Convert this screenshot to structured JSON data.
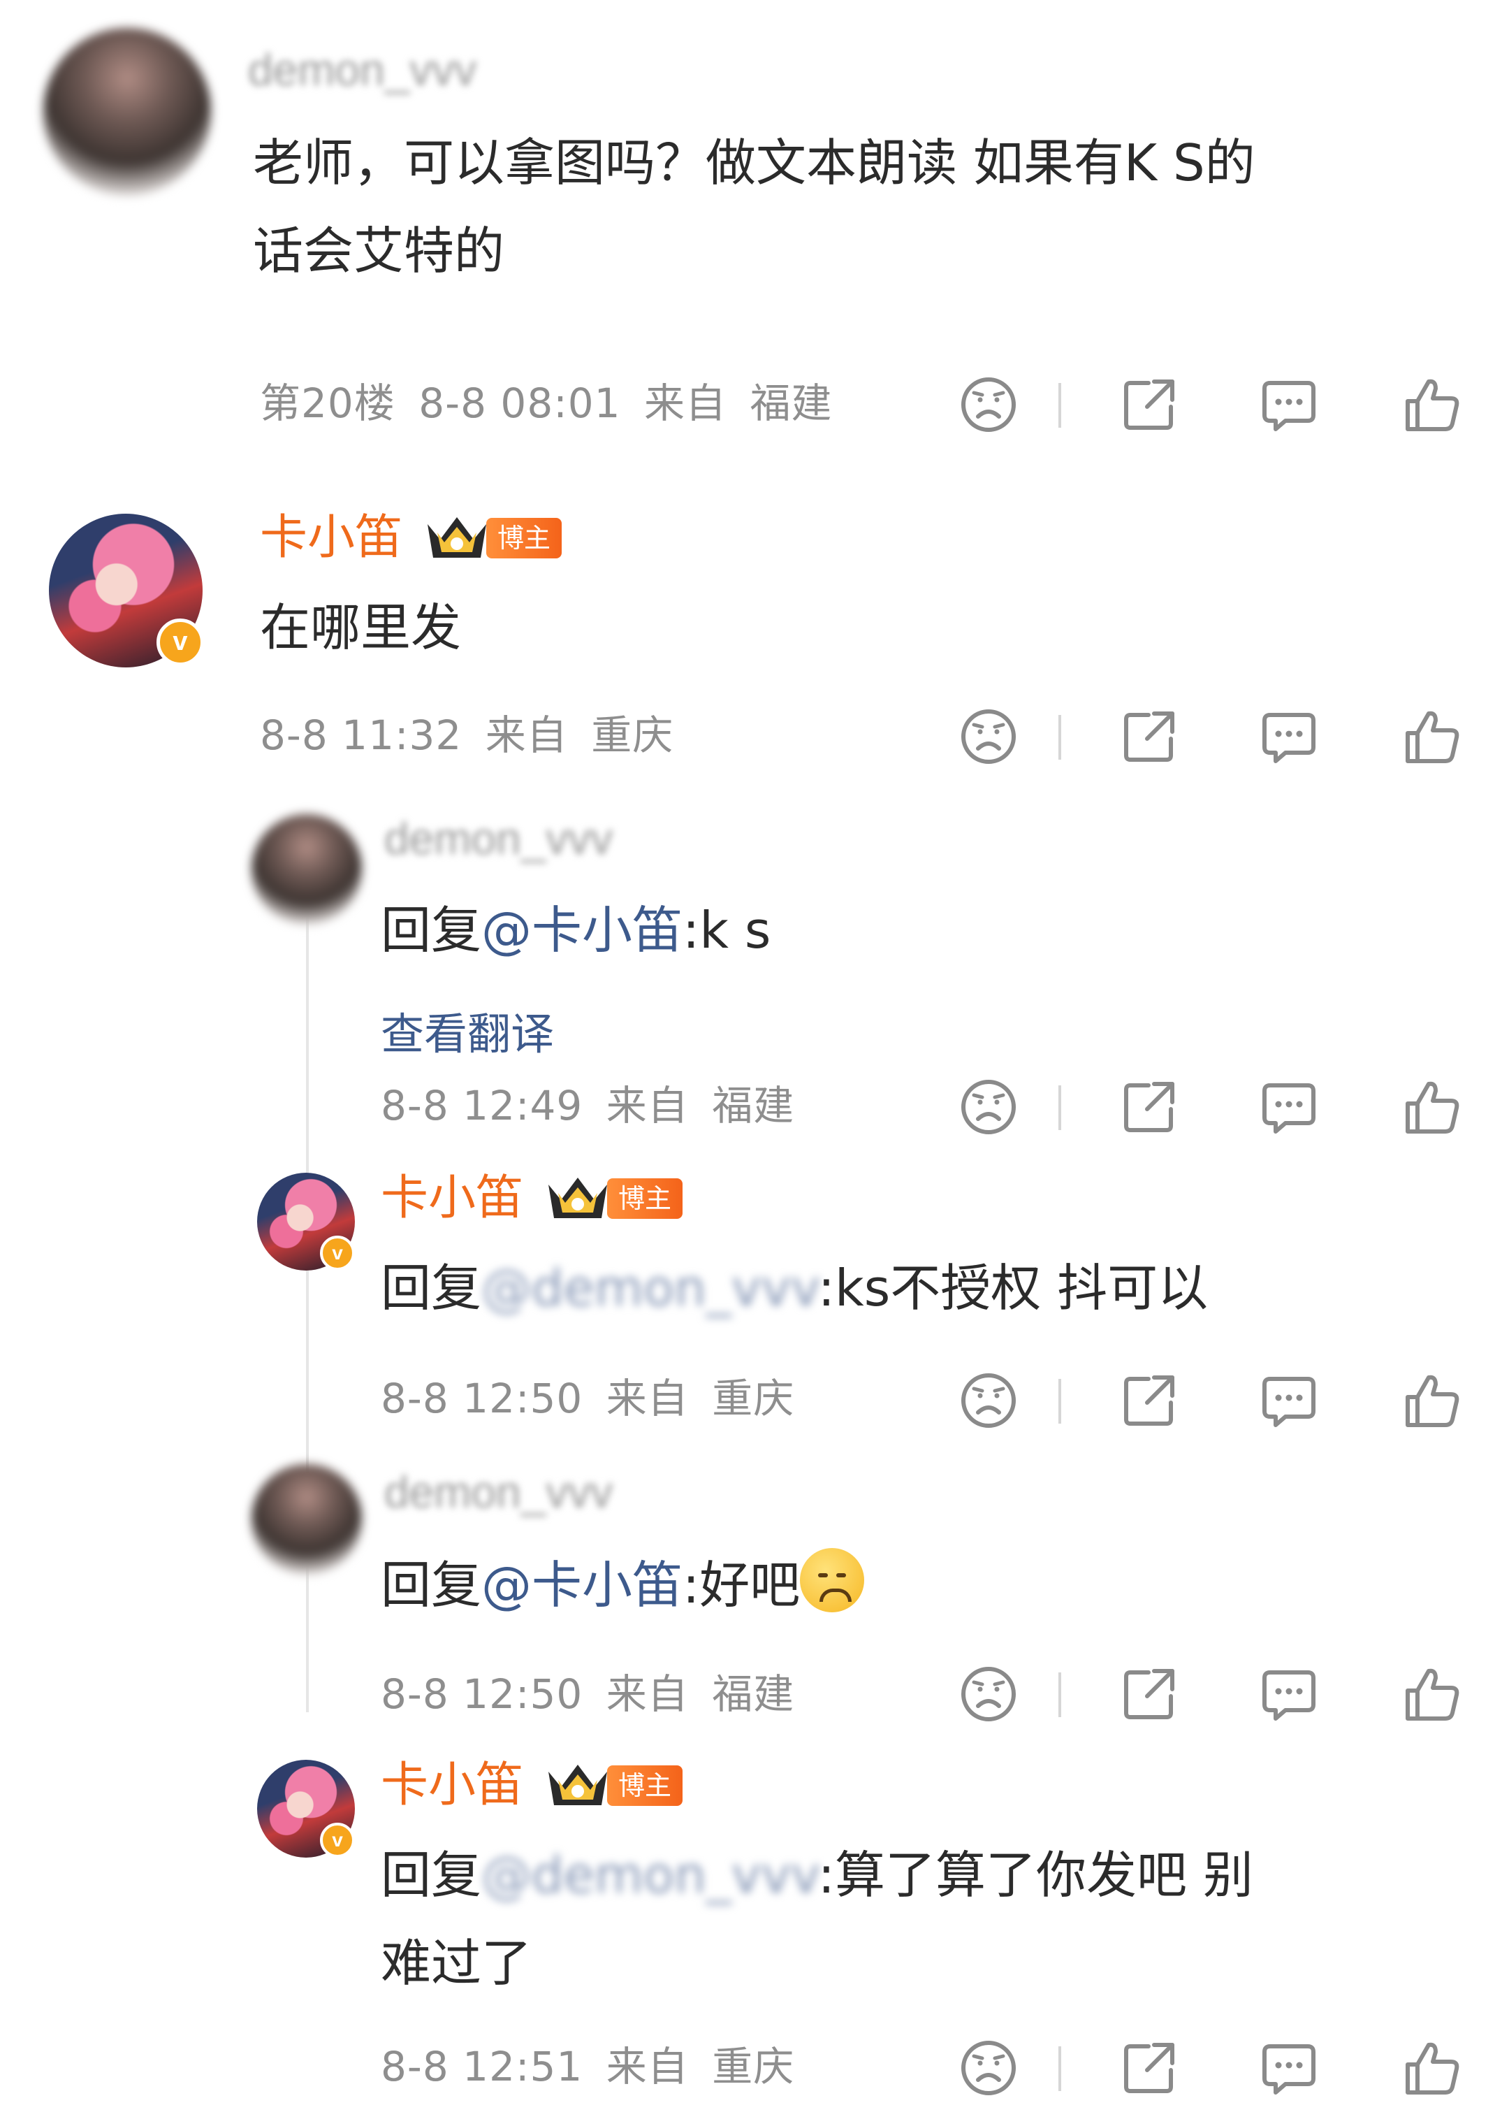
{
  "comments": [
    {
      "username": "demon_vvv",
      "text_line1": "老师，可以拿图吗？做文本朗读  如果有K S的",
      "text_line2": "话会艾特的",
      "floor": "第20楼",
      "time": "8-8 08:01",
      "from_label": "来自",
      "location": "福建"
    },
    {
      "username": "卡小笛",
      "badge": "博主",
      "text": "在哪里发",
      "time": "8-8 11:32",
      "from_label": "来自",
      "location": "重庆"
    }
  ],
  "replies": [
    {
      "username": "demon_vvv",
      "prefix": "回复",
      "mention": "@卡小笛",
      "suffix": ":k s",
      "translate_link": "查看翻译",
      "time": "8-8 12:49",
      "from_label": "来自",
      "location": "福建"
    },
    {
      "username": "卡小笛",
      "badge": "博主",
      "prefix": "回复",
      "mention": "@demon_vvv",
      "suffix": ":ks不授权 抖可以",
      "time": "8-8 12:50",
      "from_label": "来自",
      "location": "重庆"
    },
    {
      "username": "demon_vvv",
      "prefix": "回复",
      "mention": "@卡小笛",
      "suffix": ":好吧",
      "emoji": "sad-face-emoji",
      "time": "8-8 12:50",
      "from_label": "来自",
      "location": "福建"
    },
    {
      "username": "卡小笛",
      "badge": "博主",
      "prefix": "回复",
      "mention": "@demon_vvv",
      "suffix_line1": ":算了算了你发吧 别",
      "suffix_line2": "难过了",
      "time": "8-8 12:51",
      "from_label": "来自",
      "location": "重庆"
    }
  ],
  "icons": {
    "dislike": "sad-face-icon",
    "share": "share-icon",
    "comment": "comment-icon",
    "like": "thumbs-up-icon",
    "verified": "verified-v-icon",
    "crown": "crown-badge-icon"
  },
  "verified_mark": "v",
  "colors": {
    "name_orange": "#ef6a1b",
    "mention_blue": "#3d5a8c",
    "meta_gray": "#8e8e8e",
    "badge_orange": "#f4631a",
    "verified_yellow": "#f7a51c"
  }
}
